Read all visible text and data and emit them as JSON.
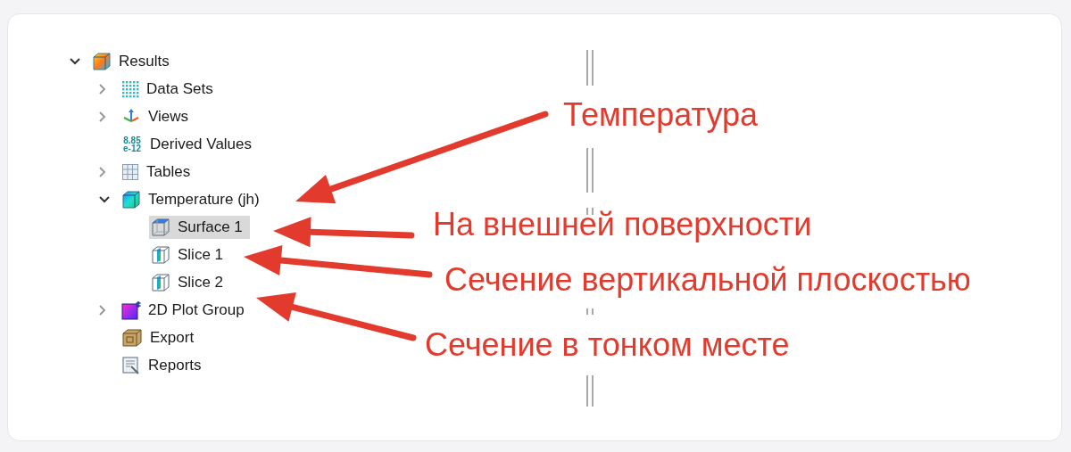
{
  "tree": [
    {
      "label": "Results",
      "kind": "results",
      "expanded": true,
      "children": [
        {
          "label": "Data Sets",
          "kind": "datasets",
          "expanded": false
        },
        {
          "label": "Views",
          "kind": "views",
          "expanded": false
        },
        {
          "label": "Derived Values",
          "kind": "derived",
          "icon_lines": [
            "8.85",
            "e-12"
          ]
        },
        {
          "label": "Tables",
          "kind": "tables",
          "expanded": false
        },
        {
          "label": "Temperature (jh)",
          "kind": "temperature",
          "expanded": true,
          "children": [
            {
              "label": "Surface 1",
              "kind": "surface",
              "selected": true
            },
            {
              "label": "Slice 1",
              "kind": "slice",
              "selected": false
            },
            {
              "label": "Slice 2",
              "kind": "slice",
              "selected": false
            }
          ]
        },
        {
          "label": "2D Plot Group",
          "kind": "plot2d",
          "expanded": false
        },
        {
          "label": "Export",
          "kind": "export"
        },
        {
          "label": "Reports",
          "kind": "reports"
        }
      ]
    }
  ],
  "annotations": [
    {
      "text": "Температура"
    },
    {
      "text": "На внешней поверхности"
    },
    {
      "text": "Сечение вертикальной плоскостью"
    },
    {
      "text": "Сечение в тонком месте"
    }
  ]
}
